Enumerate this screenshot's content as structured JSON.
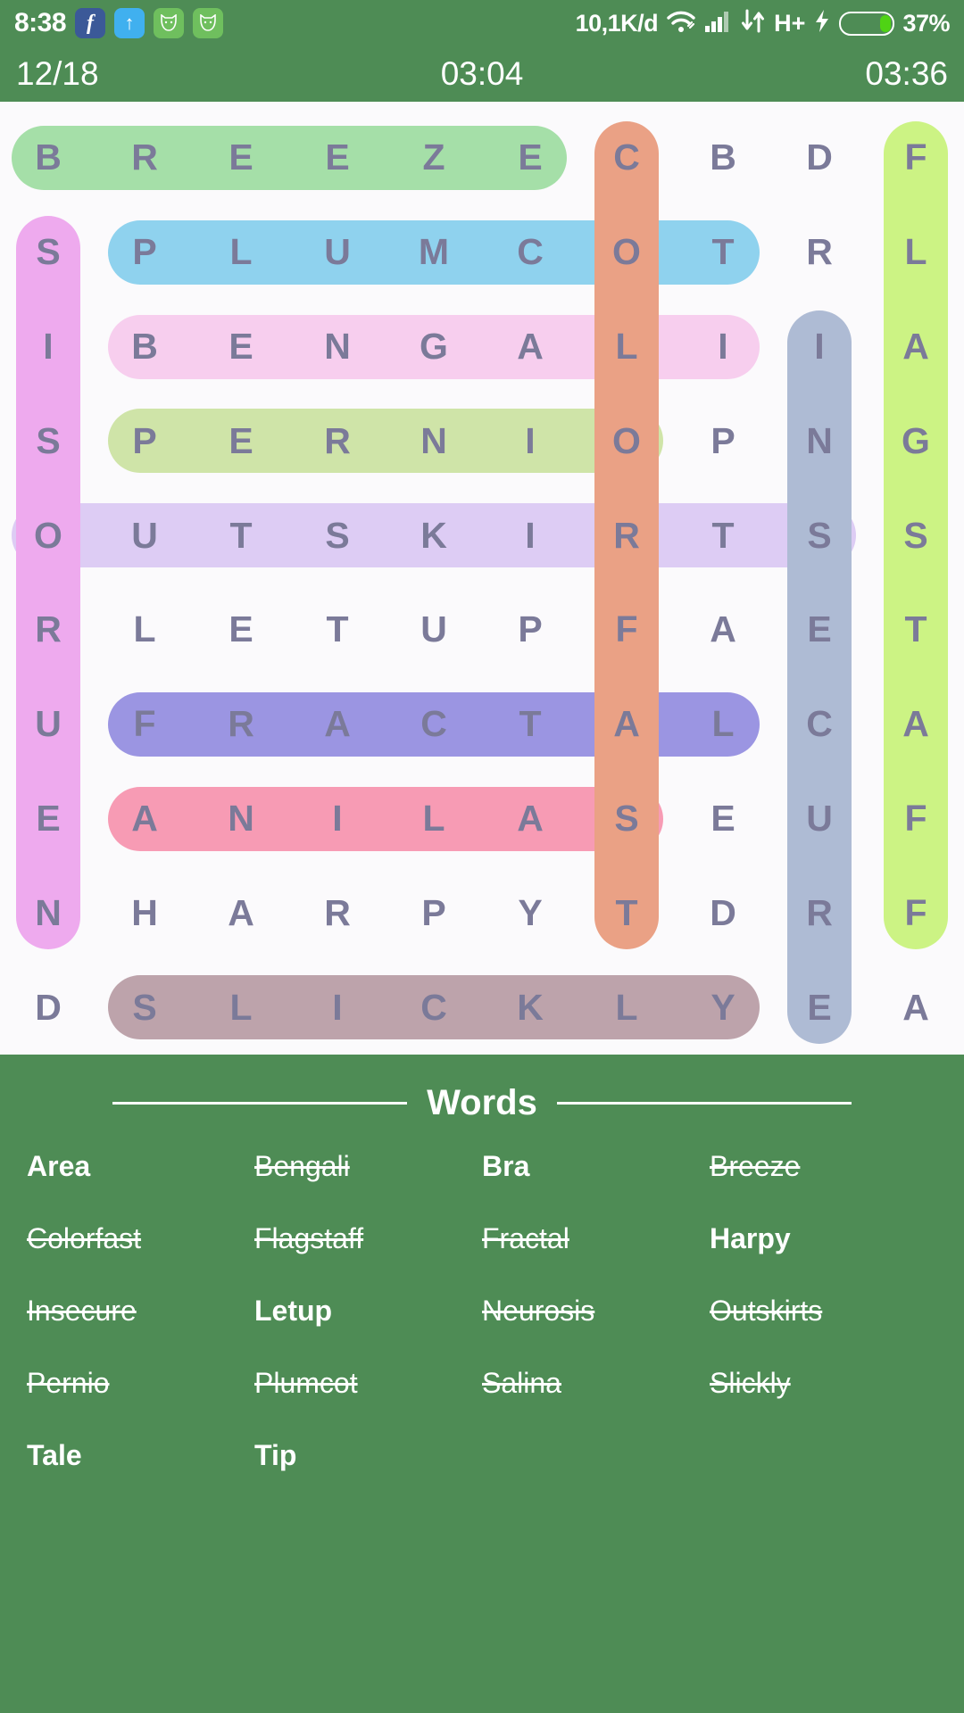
{
  "statusbar": {
    "time": "8:38",
    "apps": [
      {
        "name": "facebook-app-icon",
        "glyph": "f"
      },
      {
        "name": "upload-app-icon",
        "glyph": "↑"
      },
      {
        "name": "cat-app-icon-1",
        "glyph": ""
      },
      {
        "name": "cat-app-icon-2",
        "glyph": ""
      }
    ],
    "data_rate": "10,1K/d",
    "network_type": "H+",
    "battery_percent": "37%",
    "battery_level": 37,
    "icons": [
      "wifi-icon",
      "signal-icon",
      "data-transfer-icon",
      "charging-bolt-icon",
      "battery-icon"
    ]
  },
  "gameheader": {
    "progress": "12/18",
    "elapsed": "03:04",
    "best": "03:36"
  },
  "grid": {
    "rows": 10,
    "cols": 10,
    "letters": [
      [
        "B",
        "R",
        "E",
        "E",
        "Z",
        "E",
        "C",
        "B",
        "D",
        "F"
      ],
      [
        "S",
        "P",
        "L",
        "U",
        "M",
        "C",
        "O",
        "T",
        "R",
        "L"
      ],
      [
        "I",
        "B",
        "E",
        "N",
        "G",
        "A",
        "L",
        "I",
        "I",
        "A"
      ],
      [
        "S",
        "P",
        "E",
        "R",
        "N",
        "I",
        "O",
        "P",
        "N",
        "G"
      ],
      [
        "O",
        "U",
        "T",
        "S",
        "K",
        "I",
        "R",
        "T",
        "S",
        "S"
      ],
      [
        "R",
        "L",
        "E",
        "T",
        "U",
        "P",
        "F",
        "A",
        "E",
        "T"
      ],
      [
        "U",
        "F",
        "R",
        "A",
        "C",
        "T",
        "A",
        "L",
        "C",
        "A"
      ],
      [
        "E",
        "A",
        "N",
        "I",
        "L",
        "A",
        "S",
        "E",
        "U",
        "F"
      ],
      [
        "N",
        "H",
        "A",
        "R",
        "P",
        "Y",
        "T",
        "D",
        "R",
        "F"
      ],
      [
        "D",
        "S",
        "L",
        "I",
        "C",
        "K",
        "L",
        "Y",
        "E",
        "A"
      ]
    ],
    "highlights": [
      {
        "word": "BREEZE",
        "orientation": "horizontal",
        "row": 0,
        "col": 0,
        "length": 6,
        "color": "#a5dfa8"
      },
      {
        "word": "PLUMCOT",
        "orientation": "horizontal",
        "row": 1,
        "col": 1,
        "length": 7,
        "color": "#8fd2ee"
      },
      {
        "word": "BENGALI",
        "orientation": "horizontal",
        "row": 2,
        "col": 1,
        "length": 7,
        "color": "#f7ceee"
      },
      {
        "word": "PERNIO",
        "orientation": "horizontal",
        "row": 3,
        "col": 1,
        "length": 6,
        "color": "#cfe4a8"
      },
      {
        "word": "OUTSKIRTS",
        "orientation": "horizontal",
        "row": 4,
        "col": 0,
        "length": 9,
        "color": "#ddccf4"
      },
      {
        "word": "FRACTAL",
        "orientation": "horizontal",
        "row": 6,
        "col": 1,
        "length": 7,
        "color": "#9b95e2"
      },
      {
        "word": "SALINA",
        "orientation": "horizontal",
        "row": 7,
        "col": 1,
        "length": 6,
        "color": "#f79bb4"
      },
      {
        "word": "SLICKLY",
        "orientation": "horizontal",
        "row": 9,
        "col": 1,
        "length": 7,
        "color": "#bda3ab"
      },
      {
        "word": "NEUROSIS",
        "orientation": "vertical",
        "row": 1,
        "col": 0,
        "length": 8,
        "color": "#eeaaee"
      },
      {
        "word": "COLORFAST",
        "orientation": "vertical",
        "row": 0,
        "col": 6,
        "length": 9,
        "color": "#eaa185"
      },
      {
        "word": "INSECURE",
        "orientation": "vertical",
        "row": 2,
        "col": 8,
        "length": 8,
        "color": "#aebbd4"
      },
      {
        "word": "FLAGSTAFF",
        "orientation": "vertical",
        "row": 0,
        "col": 9,
        "length": 9,
        "color": "#ccf384"
      }
    ]
  },
  "words_panel": {
    "title": "Words",
    "items": [
      {
        "label": "Area",
        "found": false
      },
      {
        "label": "Bengali",
        "found": true
      },
      {
        "label": "Bra",
        "found": false
      },
      {
        "label": "Breeze",
        "found": true
      },
      {
        "label": "Colorfast",
        "found": true
      },
      {
        "label": "Flagstaff",
        "found": true
      },
      {
        "label": "Fractal",
        "found": true
      },
      {
        "label": "Harpy",
        "found": false
      },
      {
        "label": "Insecure",
        "found": true
      },
      {
        "label": "Letup",
        "found": false
      },
      {
        "label": "Neurosis",
        "found": true
      },
      {
        "label": "Outskirts",
        "found": true
      },
      {
        "label": "Pernio",
        "found": true
      },
      {
        "label": "Plumcot",
        "found": true
      },
      {
        "label": "Salina",
        "found": true
      },
      {
        "label": "Slickly",
        "found": true
      },
      {
        "label": "Tale",
        "found": false
      },
      {
        "label": "Tip",
        "found": false
      }
    ]
  },
  "colors": {
    "brand_green": "#4e8c55",
    "grid_bg": "#fbfafc",
    "letter": "#7b7a99"
  }
}
